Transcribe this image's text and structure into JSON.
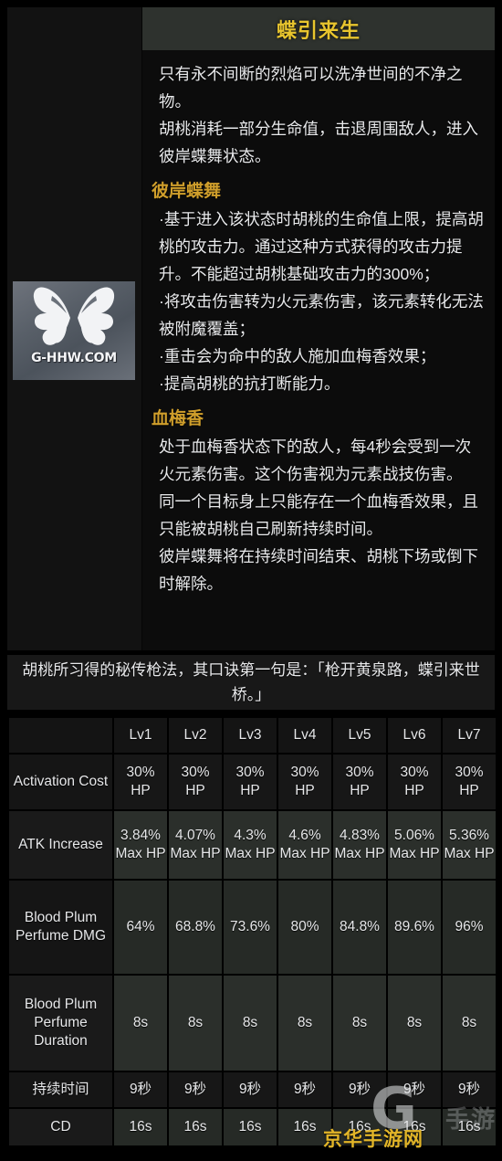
{
  "skill": {
    "title": "蝶引来生",
    "icon_name": "butterfly-skill-icon",
    "icon_watermark": "G-HHW.COM",
    "intro": [
      "只有永不间断的烈焰可以洗净世间的不净之物。",
      "胡桃消耗一部分生命值，击退周围敌人，进入彼岸蝶舞状态。"
    ],
    "sections": [
      {
        "heading": "彼岸蝶舞",
        "bullets": [
          "·基于进入该状态时胡桃的生命值上限，提高胡桃的攻击力。通过这种方式获得的攻击力提升。不能超过胡桃基础攻击力的300%；",
          "·将攻击伤害转为火元素伤害，该元素转化无法被附魔覆盖；",
          "·重击会为命中的敌人施加血梅香效果；",
          "·提高胡桃的抗打断能力。"
        ]
      },
      {
        "heading": "血梅香",
        "paragraphs": [
          "处于血梅香状态下的敌人，每4秒会受到一次火元素伤害。这个伤害视为元素战技伤害。",
          "同一个目标身上只能存在一个血梅香效果，且只能被胡桃自己刷新持续时间。",
          "彼岸蝶舞将在持续时间结束、胡桃下场或倒下时解除。"
        ]
      }
    ],
    "quote": "胡桃所习得的秘传枪法，其口诀第一句是：「枪开黄泉路，蝶引来世桥。」"
  },
  "table": {
    "corner_label": "",
    "columns": [
      "Lv1",
      "Lv2",
      "Lv3",
      "Lv4",
      "Lv5",
      "Lv6",
      "Lv7"
    ],
    "rows": [
      {
        "label": "Activation Cost",
        "values": [
          "30% HP",
          "30% HP",
          "30% HP",
          "30% HP",
          "30% HP",
          "30% HP",
          "30% HP"
        ]
      },
      {
        "label": "ATK Increase",
        "values": [
          "3.84% Max HP",
          "4.07% Max HP",
          "4.3% Max HP",
          "4.6% Max HP",
          "4.83% Max HP",
          "5.06% Max HP",
          "5.36% Max HP"
        ]
      },
      {
        "label": "Blood Plum Perfume DMG",
        "values": [
          "64%",
          "68.8%",
          "73.6%",
          "80%",
          "84.8%",
          "89.6%",
          "96%"
        ]
      },
      {
        "label": "Blood Plum Perfume Duration",
        "values": [
          "8s",
          "8s",
          "8s",
          "8s",
          "8s",
          "8s",
          "8s"
        ]
      },
      {
        "label": "持续时间",
        "values": [
          "9秒",
          "9秒",
          "9秒",
          "9秒",
          "9秒",
          "9秒",
          "9秒"
        ]
      },
      {
        "label": "CD",
        "values": [
          "16s",
          "16s",
          "16s",
          "16s",
          "16s",
          "16s",
          "16s"
        ]
      }
    ]
  },
  "watermark": {
    "logo_letter": "G",
    "site_name": "京华手游网",
    "faint_text": "手游"
  },
  "colors": {
    "title_gold": "#e8c52e",
    "section_gold": "#cf9e2b",
    "body_text": "#e9eaec",
    "title_bar_bg": "#2e322e",
    "olive_cell": "#2b2f2b",
    "page_bg": "#000000"
  }
}
